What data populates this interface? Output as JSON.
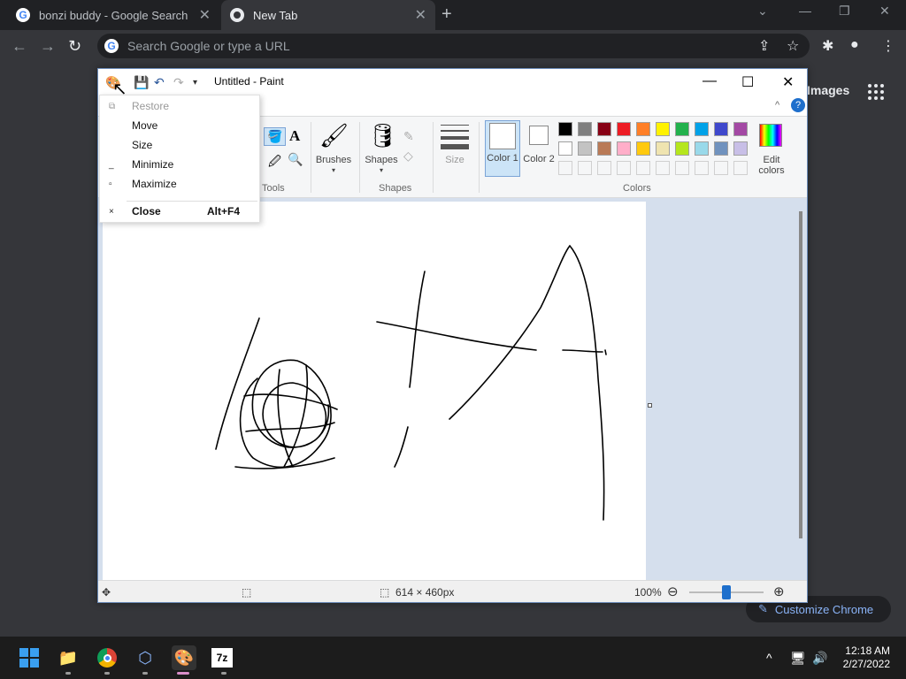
{
  "browser": {
    "tabs": [
      {
        "label": "bonzi buddy - Google Search",
        "close": "✕"
      },
      {
        "label": "New Tab",
        "close": "✕"
      }
    ],
    "omnibox_placeholder": "Search Google or type a URL",
    "ntp": {
      "images_link": "Images",
      "customize_label": "Customize Chrome"
    }
  },
  "paint": {
    "title": "Untitled - Paint",
    "ribbon": {
      "brushes_label": "Brushes",
      "shapes_label": "Shapes",
      "size_label": "Size",
      "color1_label": "Color 1",
      "color2_label": "Color 2",
      "edit_colors_label": "Edit colors",
      "groups": {
        "tools": "Tools",
        "shapes": "Shapes",
        "colors": "Colors"
      }
    },
    "palette": [
      "#000000",
      "#7f7f7f",
      "#880015",
      "#ed1c24",
      "#ff7f27",
      "#fff200",
      "#22b14c",
      "#00a2e8",
      "#3f48cc",
      "#a349a4",
      "#ffffff",
      "#c3c3c3",
      "#b97a57",
      "#ffaec9",
      "#ffc90e",
      "#efe4b0",
      "#b5e61d",
      "#99d9ea",
      "#7092be",
      "#c8bfe7"
    ],
    "status": {
      "canvas_size": "614 × 460px",
      "zoom": "100%"
    }
  },
  "system_menu": {
    "items": [
      {
        "label": "Restore",
        "glyph": "⧉",
        "disabled": true
      },
      {
        "label": "Move",
        "glyph": "",
        "disabled": false
      },
      {
        "label": "Size",
        "glyph": "",
        "disabled": false
      },
      {
        "label": "Minimize",
        "glyph": "_",
        "disabled": false
      },
      {
        "label": "Maximize",
        "glyph": "▫",
        "disabled": false
      },
      {
        "label": "Close",
        "glyph": "×",
        "shortcut": "Alt+F4",
        "disabled": false
      }
    ]
  },
  "taskbar": {
    "time": "12:18 AM",
    "date": "2/27/2022"
  }
}
